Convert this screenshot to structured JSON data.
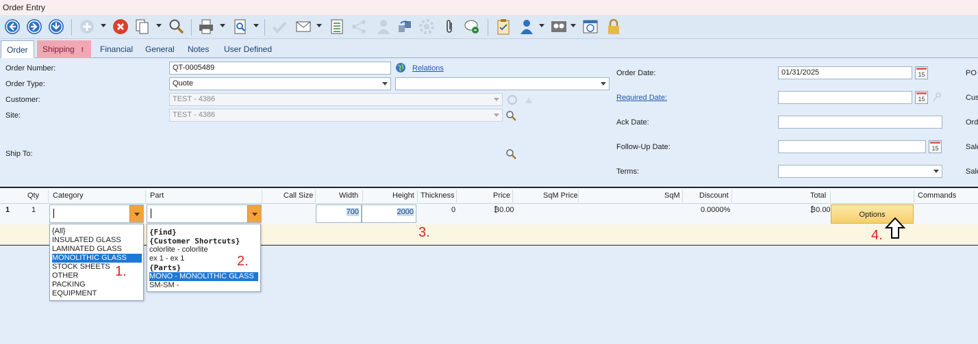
{
  "window": {
    "title": "Order Entry"
  },
  "tabs": [
    {
      "label": "Order"
    },
    {
      "label": "Shipping",
      "badge": "!"
    },
    {
      "label": "Financial"
    },
    {
      "label": "General"
    },
    {
      "label": "Notes"
    },
    {
      "label": "User Defined"
    }
  ],
  "form": {
    "order_number_label": "Order Number:",
    "order_number_value": "QT-0005489",
    "relations_link": "Relations",
    "order_type_label": "Order Type:",
    "order_type_value": "Quote",
    "order_type_secondary": "",
    "customer_label": "Customer:",
    "customer_value": "TEST - 4386",
    "site_label": "Site:",
    "site_value": "TEST - 4386",
    "ship_to_label": "Ship To:",
    "order_date_label": "Order Date:",
    "order_date_value": "01/31/2025",
    "required_date_label": "Required Date:",
    "required_date_value": "",
    "ack_date_label": "Ack Date:",
    "ack_date_value": "",
    "follow_up_label": "Follow-Up Date:",
    "follow_up_value": "",
    "terms_label": "Terms:",
    "terms_value": "",
    "cut_labels": [
      "PO",
      "Cus",
      "Ord",
      "Sale",
      "Sale"
    ],
    "calendar_label": "15"
  },
  "grid": {
    "headers": [
      "Qty",
      "Category",
      "Part",
      "Call Size",
      "Width",
      "Height",
      "Thickness",
      "Price",
      "SqM Price",
      "SqM",
      "Discount",
      "Total",
      "Commands"
    ],
    "row": {
      "line": "1",
      "qty": "1",
      "category": "",
      "part": "",
      "width": "700",
      "height": "2000",
      "thickness": "0",
      "price": "₿0.00",
      "discount": "0.0000%",
      "total": "₿0.00",
      "options_label": "Options"
    }
  },
  "category_dropdown": {
    "items": [
      "{All}",
      "INSULATED GLASS",
      "LAMINATED GLASS",
      "MONOLITHIC GLASS",
      "STOCK SHEETS",
      "OTHER",
      "PACKING",
      "EQUIPMENT"
    ],
    "selected": "MONOLITHIC GLASS"
  },
  "part_dropdown": {
    "items": [
      {
        "text": "{Find}",
        "bold": true
      },
      {
        "text": "{Customer Shortcuts}",
        "bold": true
      },
      {
        "text": "colorlite - colorlite",
        "bold": false
      },
      {
        "text": "ex 1 - ex 1",
        "bold": false
      },
      {
        "text": "{Parts}",
        "bold": true
      },
      {
        "text": "MONO - MONOLITHIC GLASS",
        "bold": false
      },
      {
        "text": "SM-SM -",
        "bold": false
      }
    ],
    "selected": "MONO - MONOLITHIC GLASS"
  },
  "annotations": [
    "1.",
    "2.",
    "3.",
    "4."
  ],
  "colors": {
    "accent": "#1e78d4",
    "orange": "#f4a23c",
    "annotation": "#dd2222"
  }
}
